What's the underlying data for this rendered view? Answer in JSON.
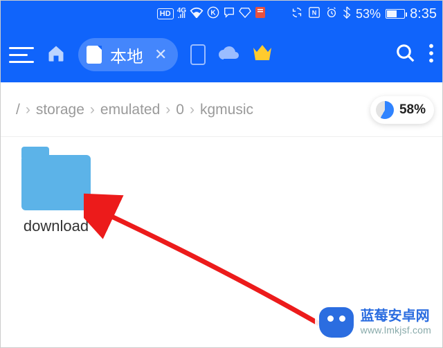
{
  "status": {
    "hd": "HD",
    "net": "4G",
    "battery_pct": "53%",
    "time": "8:35"
  },
  "toolbar": {
    "tab_label": "本地"
  },
  "breadcrumb": {
    "root": "/",
    "seg1": "storage",
    "seg2": "emulated",
    "seg3": "0",
    "seg4": "kgmusic",
    "usage_pct": "58%"
  },
  "folders": {
    "item0": {
      "name": "download"
    }
  },
  "watermark": {
    "title": "蓝莓安卓网",
    "url": "www.lmkjsf.com"
  }
}
